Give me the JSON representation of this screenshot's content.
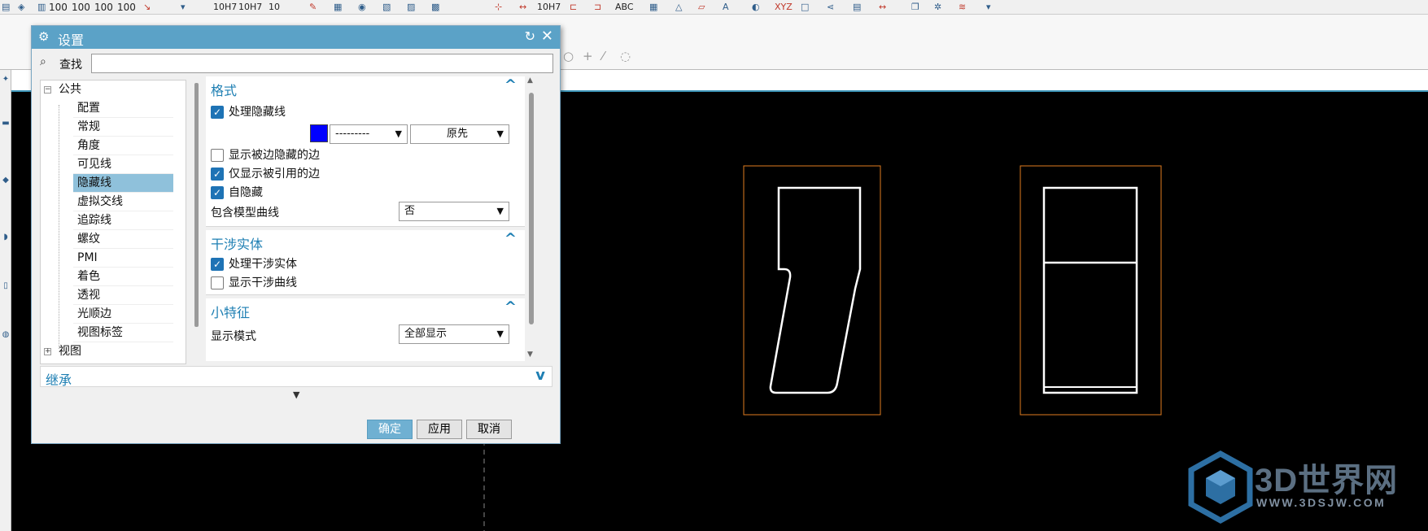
{
  "toolbar": {
    "dim_labels": [
      "100",
      "100",
      "100",
      "100"
    ],
    "tol_labels": [
      "10H7",
      "10H7"
    ],
    "tol_single": "10H7",
    "abc_label": "ABC",
    "xyz_label": "XYZ",
    "ten_label": "10"
  },
  "dialog": {
    "title": "设置",
    "search_label": "查找",
    "search_value": "",
    "tree": {
      "root_label": "公共",
      "children": [
        "配置",
        "常规",
        "角度",
        "可见线",
        "隐藏线",
        "虚拟交线",
        "追踪线",
        "螺纹",
        "PMI",
        "着色",
        "透视",
        "光顺边",
        "视图标签"
      ],
      "selected": "隐藏线",
      "next_root_label": "视图"
    },
    "sections": {
      "format": {
        "title": "格式",
        "process_hidden": {
          "label": "处理隐藏线",
          "checked": true
        },
        "line_color": "#0000ff",
        "line_style_value": "---------",
        "line_width_value": "原先",
        "show_hidden_edges": {
          "label": "显示被边隐藏的边",
          "checked": false
        },
        "show_referenced_only": {
          "label": "仅显示被引用的边",
          "checked": true
        },
        "self_hide": {
          "label": "自隐藏",
          "checked": true
        },
        "include_model_curves_label": "包含模型曲线",
        "include_model_curves_value": "否"
      },
      "interference": {
        "title": "干涉实体",
        "process_interference": {
          "label": "处理干涉实体",
          "checked": true
        },
        "show_interference_curves": {
          "label": "显示干涉曲线",
          "checked": false
        }
      },
      "small_feature": {
        "title": "小特征",
        "display_mode_label": "显示模式",
        "display_mode_value": "全部显示"
      }
    },
    "inherit_title": "继承",
    "buttons": {
      "ok": "确定",
      "apply": "应用",
      "cancel": "取消"
    }
  },
  "watermark": {
    "title": "3D世界网",
    "url": "WWW.3DSJW.COM"
  },
  "colors": {
    "title_bar": "#5ba2c7",
    "accent": "#1e7fb3",
    "selection": "#8fc1db",
    "view_border": "#e07b1f",
    "geometry": "#ffffff"
  }
}
